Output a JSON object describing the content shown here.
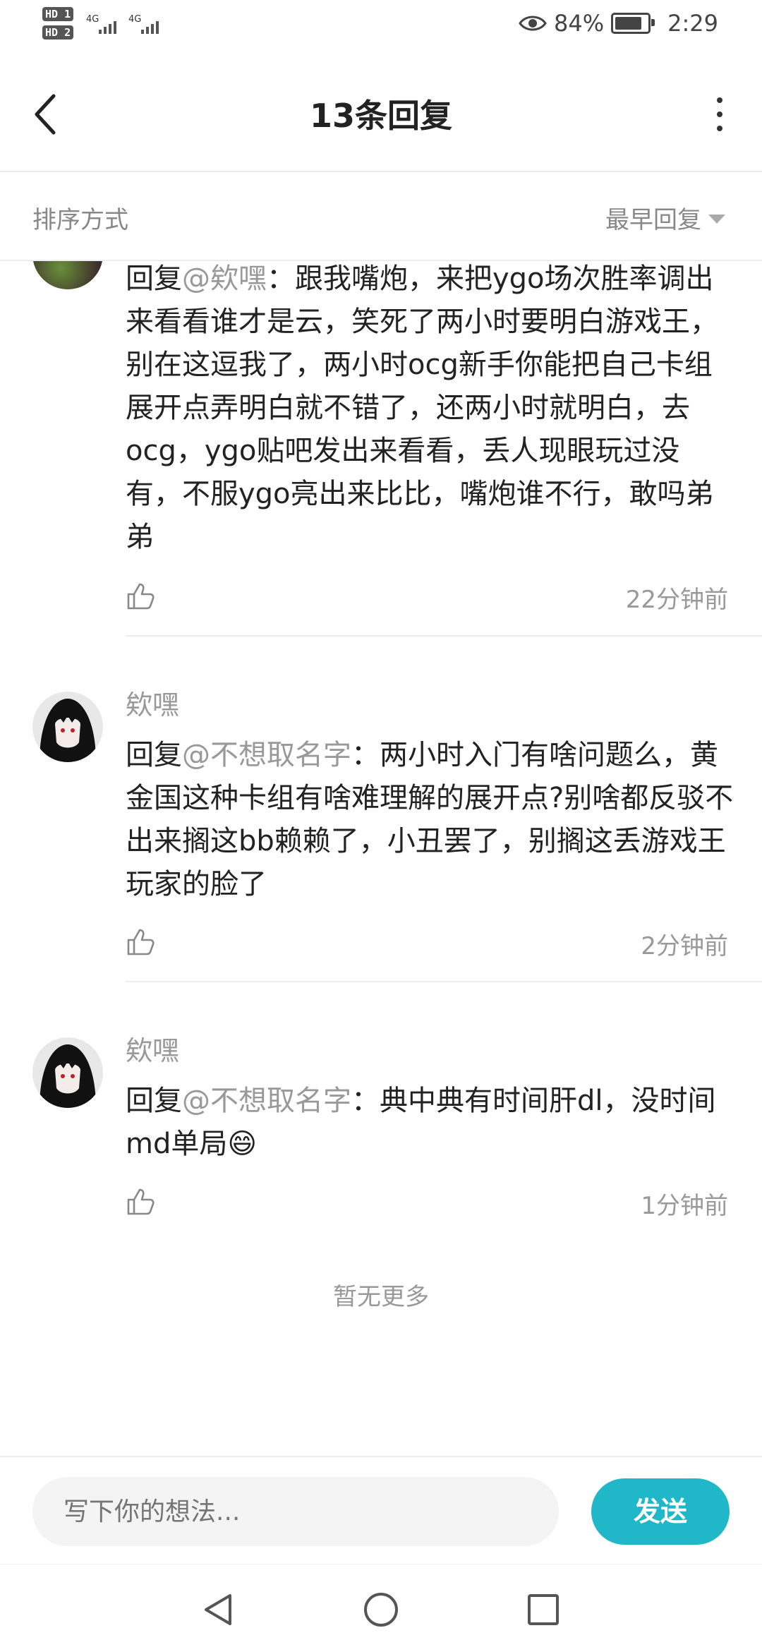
{
  "status_bar": {
    "sim1": "HD 1",
    "sim2": "HD 2",
    "net1": "4G",
    "net2": "4G",
    "battery_percent": "84%",
    "battery_level": 0.84,
    "time": "2:29",
    "icons": [
      "eye-icon",
      "battery-icon"
    ]
  },
  "header": {
    "title": "13条回复",
    "back_icon": "chevron-left-icon",
    "more_icon": "more-vertical-icon"
  },
  "sort": {
    "label": "排序方式",
    "value": "最早回复"
  },
  "comments": [
    {
      "name": "",
      "reply_prefix": "回复",
      "mention": "@欸嘿",
      "body": "：跟我嘴炮，来把ygo场次胜率调出来看看谁才是云，笑死了两小时要明白游戏王，别在这逗我了，两小时ocg新手你能把自己卡组展开点弄明白就不错了，还两小时就明白，去ocg，ygo贴吧发出来看看，丢人现眼玩过没有，不服ygo亮出来比比，嘴炮谁不行，敢吗弟弟",
      "time": "22分钟前"
    },
    {
      "name": "欸嘿",
      "reply_prefix": "回复",
      "mention": "@不想取名字",
      "body": "：两小时入门有啥问题么，黄金国这种卡组有啥难理解的展开点?别啥都反驳不出来搁这bb赖赖了，小丑罢了，别搁这丢游戏王玩家的脸了",
      "time": "2分钟前"
    },
    {
      "name": "欸嘿",
      "reply_prefix": "回复",
      "mention": "@不想取名字",
      "body": "：典中典有时间肝dl，没时间md单局😄",
      "time": "1分钟前"
    }
  ],
  "footer_note": "暂无更多",
  "input": {
    "placeholder": "写下你的想法...",
    "send_label": "发送"
  },
  "colors": {
    "accent": "#20b8c8",
    "muted_text": "#999999"
  }
}
